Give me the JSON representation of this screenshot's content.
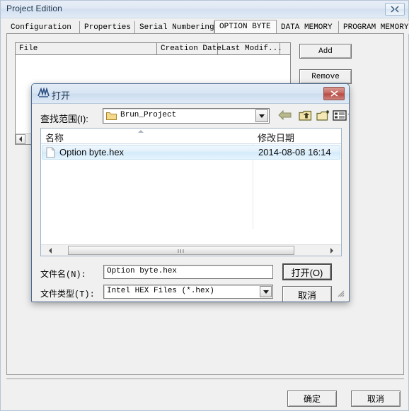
{
  "window": {
    "title": "Project Edition",
    "close_icon": "close-icon"
  },
  "tabs": [
    {
      "label": "Configuration",
      "active": false
    },
    {
      "label": "Properties",
      "active": false
    },
    {
      "label": "Serial Numbering",
      "active": false
    },
    {
      "label": "OPTION BYTE",
      "active": true
    },
    {
      "label": "DATA MEMORY",
      "active": false
    },
    {
      "label": "PROGRAM MEMORY",
      "active": false
    }
  ],
  "file_list": {
    "columns": [
      "File",
      "Creation Date",
      "Last Modif..."
    ],
    "rows": []
  },
  "side_buttons": {
    "add": "Add",
    "remove": "Remove"
  },
  "footer": {
    "ok": "确定",
    "cancel": "取消"
  },
  "dialog": {
    "title": "打开",
    "icon": "app-window-icon",
    "close_icon": "close-icon",
    "look_in": {
      "label": "查找范围(I):",
      "value": "Brun_Project",
      "folder_icon": "folder-icon",
      "dropdown_icon": "chevron-down-icon"
    },
    "toolbar": [
      {
        "name": "back-icon",
        "title": ""
      },
      {
        "name": "up-folder-icon",
        "title": ""
      },
      {
        "name": "new-folder-icon",
        "title": ""
      },
      {
        "name": "views-icon",
        "title": ""
      }
    ],
    "list": {
      "columns": [
        "名称",
        "修改日期"
      ],
      "sort_icon": "sort-ascending-icon",
      "rows": [
        {
          "icon": "file-icon",
          "name": "Option byte.hex",
          "date": "2014-08-08 16:14",
          "selected": true
        }
      ],
      "scroll_thumb_glyph": "ııı"
    },
    "filename": {
      "label": "文件名(N):",
      "value": "Option byte.hex",
      "placeholder": ""
    },
    "filetype": {
      "label": "文件类型(T):",
      "value": "Intel HEX Files (*.hex)",
      "dropdown_icon": "chevron-down-icon"
    },
    "buttons": {
      "open": "打开(O)",
      "cancel": "取消"
    }
  },
  "colors": {
    "dialog_border": "#4a6a8e",
    "close_red": "#b6463f",
    "selection_blue": "#d2eafa",
    "face": "#f0f0f0"
  }
}
